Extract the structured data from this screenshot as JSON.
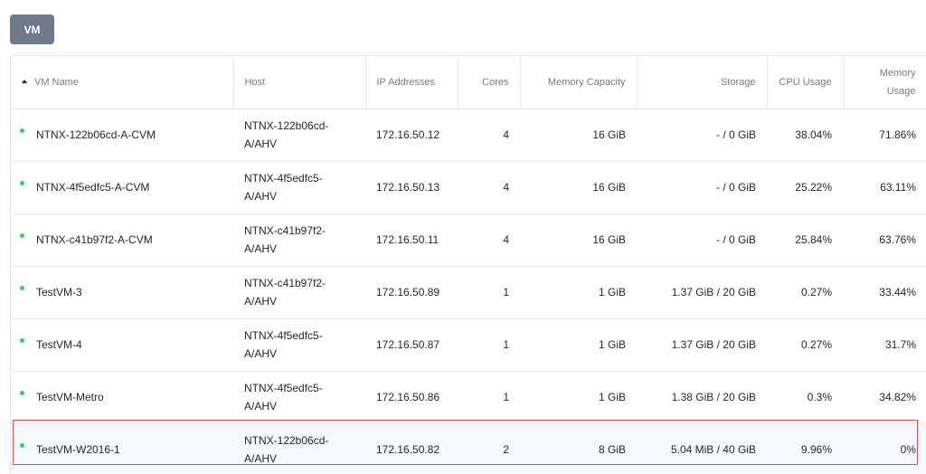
{
  "tab": {
    "label": "VM"
  },
  "columns": [
    "VM Name",
    "Host",
    "IP Addresses",
    "Cores",
    "Memory Capacity",
    "Storage",
    "CPU Usage",
    "Memory Usage"
  ],
  "rows": [
    {
      "name": "NTNX-122b06cd-A-CVM",
      "host": "NTNX-122b06cd-A/AHV",
      "ip": "172.16.50.12",
      "cores": "4",
      "memory": "16 GiB",
      "storage": "- / 0 GiB",
      "cpu": "38.04%",
      "mem_usage": "71.86%",
      "status": "on"
    },
    {
      "name": "NTNX-4f5edfc5-A-CVM",
      "host": "NTNX-4f5edfc5-A/AHV",
      "ip": "172.16.50.13",
      "cores": "4",
      "memory": "16 GiB",
      "storage": "- / 0 GiB",
      "cpu": "25.22%",
      "mem_usage": "63.11%",
      "status": "on"
    },
    {
      "name": "NTNX-c41b97f2-A-CVM",
      "host": "NTNX-c41b97f2-A/AHV",
      "ip": "172.16.50.11",
      "cores": "4",
      "memory": "16 GiB",
      "storage": "- / 0 GiB",
      "cpu": "25.84%",
      "mem_usage": "63.76%",
      "status": "on"
    },
    {
      "name": "TestVM-3",
      "host": "NTNX-c41b97f2-A/AHV",
      "ip": "172.16.50.89",
      "cores": "1",
      "memory": "1 GiB",
      "storage": "1.37 GiB / 20 GiB",
      "cpu": "0.27%",
      "mem_usage": "33.44%",
      "status": "on"
    },
    {
      "name": "TestVM-4",
      "host": "NTNX-4f5edfc5-A/AHV",
      "ip": "172.16.50.87",
      "cores": "1",
      "memory": "1 GiB",
      "storage": "1.37 GiB / 20 GiB",
      "cpu": "0.27%",
      "mem_usage": "31.7%",
      "status": "on"
    },
    {
      "name": "TestVM-Metro",
      "host": "NTNX-4f5edfc5-A/AHV",
      "ip": "172.16.50.86",
      "cores": "1",
      "memory": "1 GiB",
      "storage": "1.38 GiB / 20 GiB",
      "cpu": "0.3%",
      "mem_usage": "34.82%",
      "status": "on"
    },
    {
      "name": "TestVM-W2016-1",
      "host": "NTNX-122b06cd-A/AHV",
      "ip": "172.16.50.82",
      "cores": "2",
      "memory": "8 GiB",
      "storage": "5.04 MiB / 40 GiB",
      "cpu": "9.96%",
      "mem_usage": "0%",
      "status": "on",
      "selected": true
    }
  ],
  "colors": {
    "tab_bg": "#6c7a89",
    "status_on": "#36c96e",
    "selection_border": "#d9534f",
    "selected_row_bg": "#f3f9fc"
  },
  "icons": {
    "sort": "sort-ascending-icon",
    "status": "status-dot-icon"
  }
}
